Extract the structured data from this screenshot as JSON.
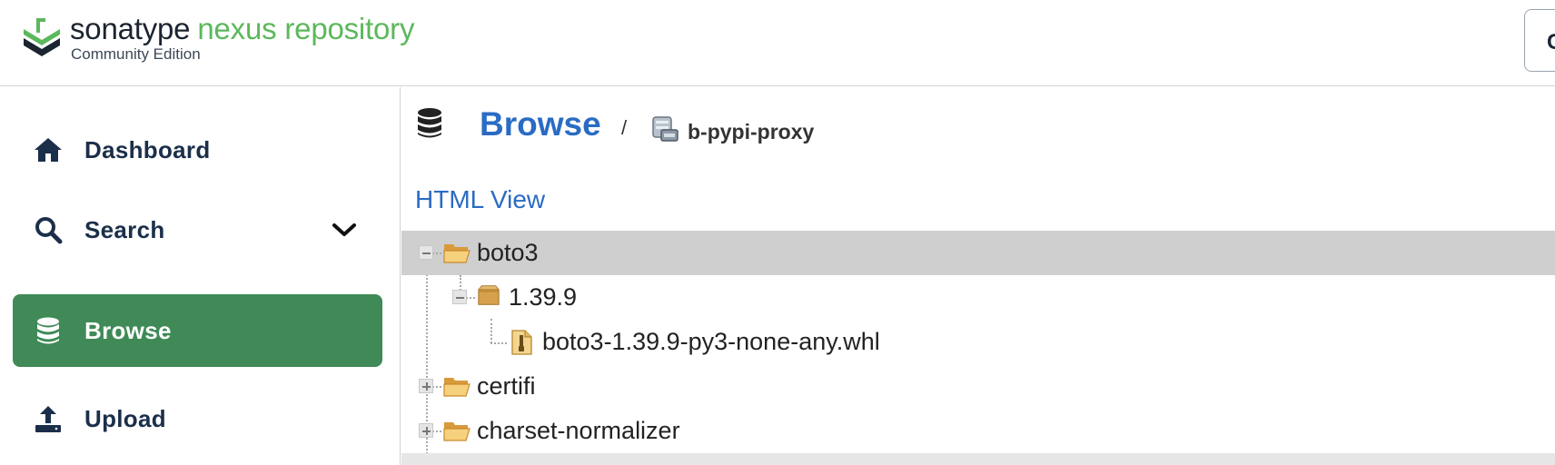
{
  "header": {
    "brand_word1": "sonatype",
    "brand_word2": "nexus repository",
    "edition": "Community Edition",
    "account_glyph": "C"
  },
  "sidebar": {
    "items": [
      {
        "label": "Dashboard",
        "icon": "home-icon",
        "active": false
      },
      {
        "label": "Search",
        "icon": "search-icon",
        "active": false,
        "expandable": true
      },
      {
        "label": "Browse",
        "icon": "database-icon",
        "active": true
      },
      {
        "label": "Upload",
        "icon": "upload-icon",
        "active": false
      }
    ]
  },
  "main": {
    "title": "Browse",
    "separator": "/",
    "repo_name": "b-pypi-proxy",
    "html_view": "HTML View",
    "tree": [
      {
        "label": "boto3",
        "type": "folder",
        "expanded": true,
        "selected": true
      },
      {
        "label": "1.39.9",
        "type": "package",
        "expanded": true
      },
      {
        "label": "boto3-1.39.9-py3-none-any.whl",
        "type": "file"
      },
      {
        "label": "certifi",
        "type": "folder",
        "expanded": false
      },
      {
        "label": "charset-normalizer",
        "type": "folder",
        "expanded": false
      }
    ]
  },
  "colors": {
    "brand_green": "#5cb85c",
    "active_nav": "#3f8a57",
    "link_blue": "#2a6bc4",
    "nav_text": "#1b2f4a",
    "selection": "#cfcfcf"
  }
}
